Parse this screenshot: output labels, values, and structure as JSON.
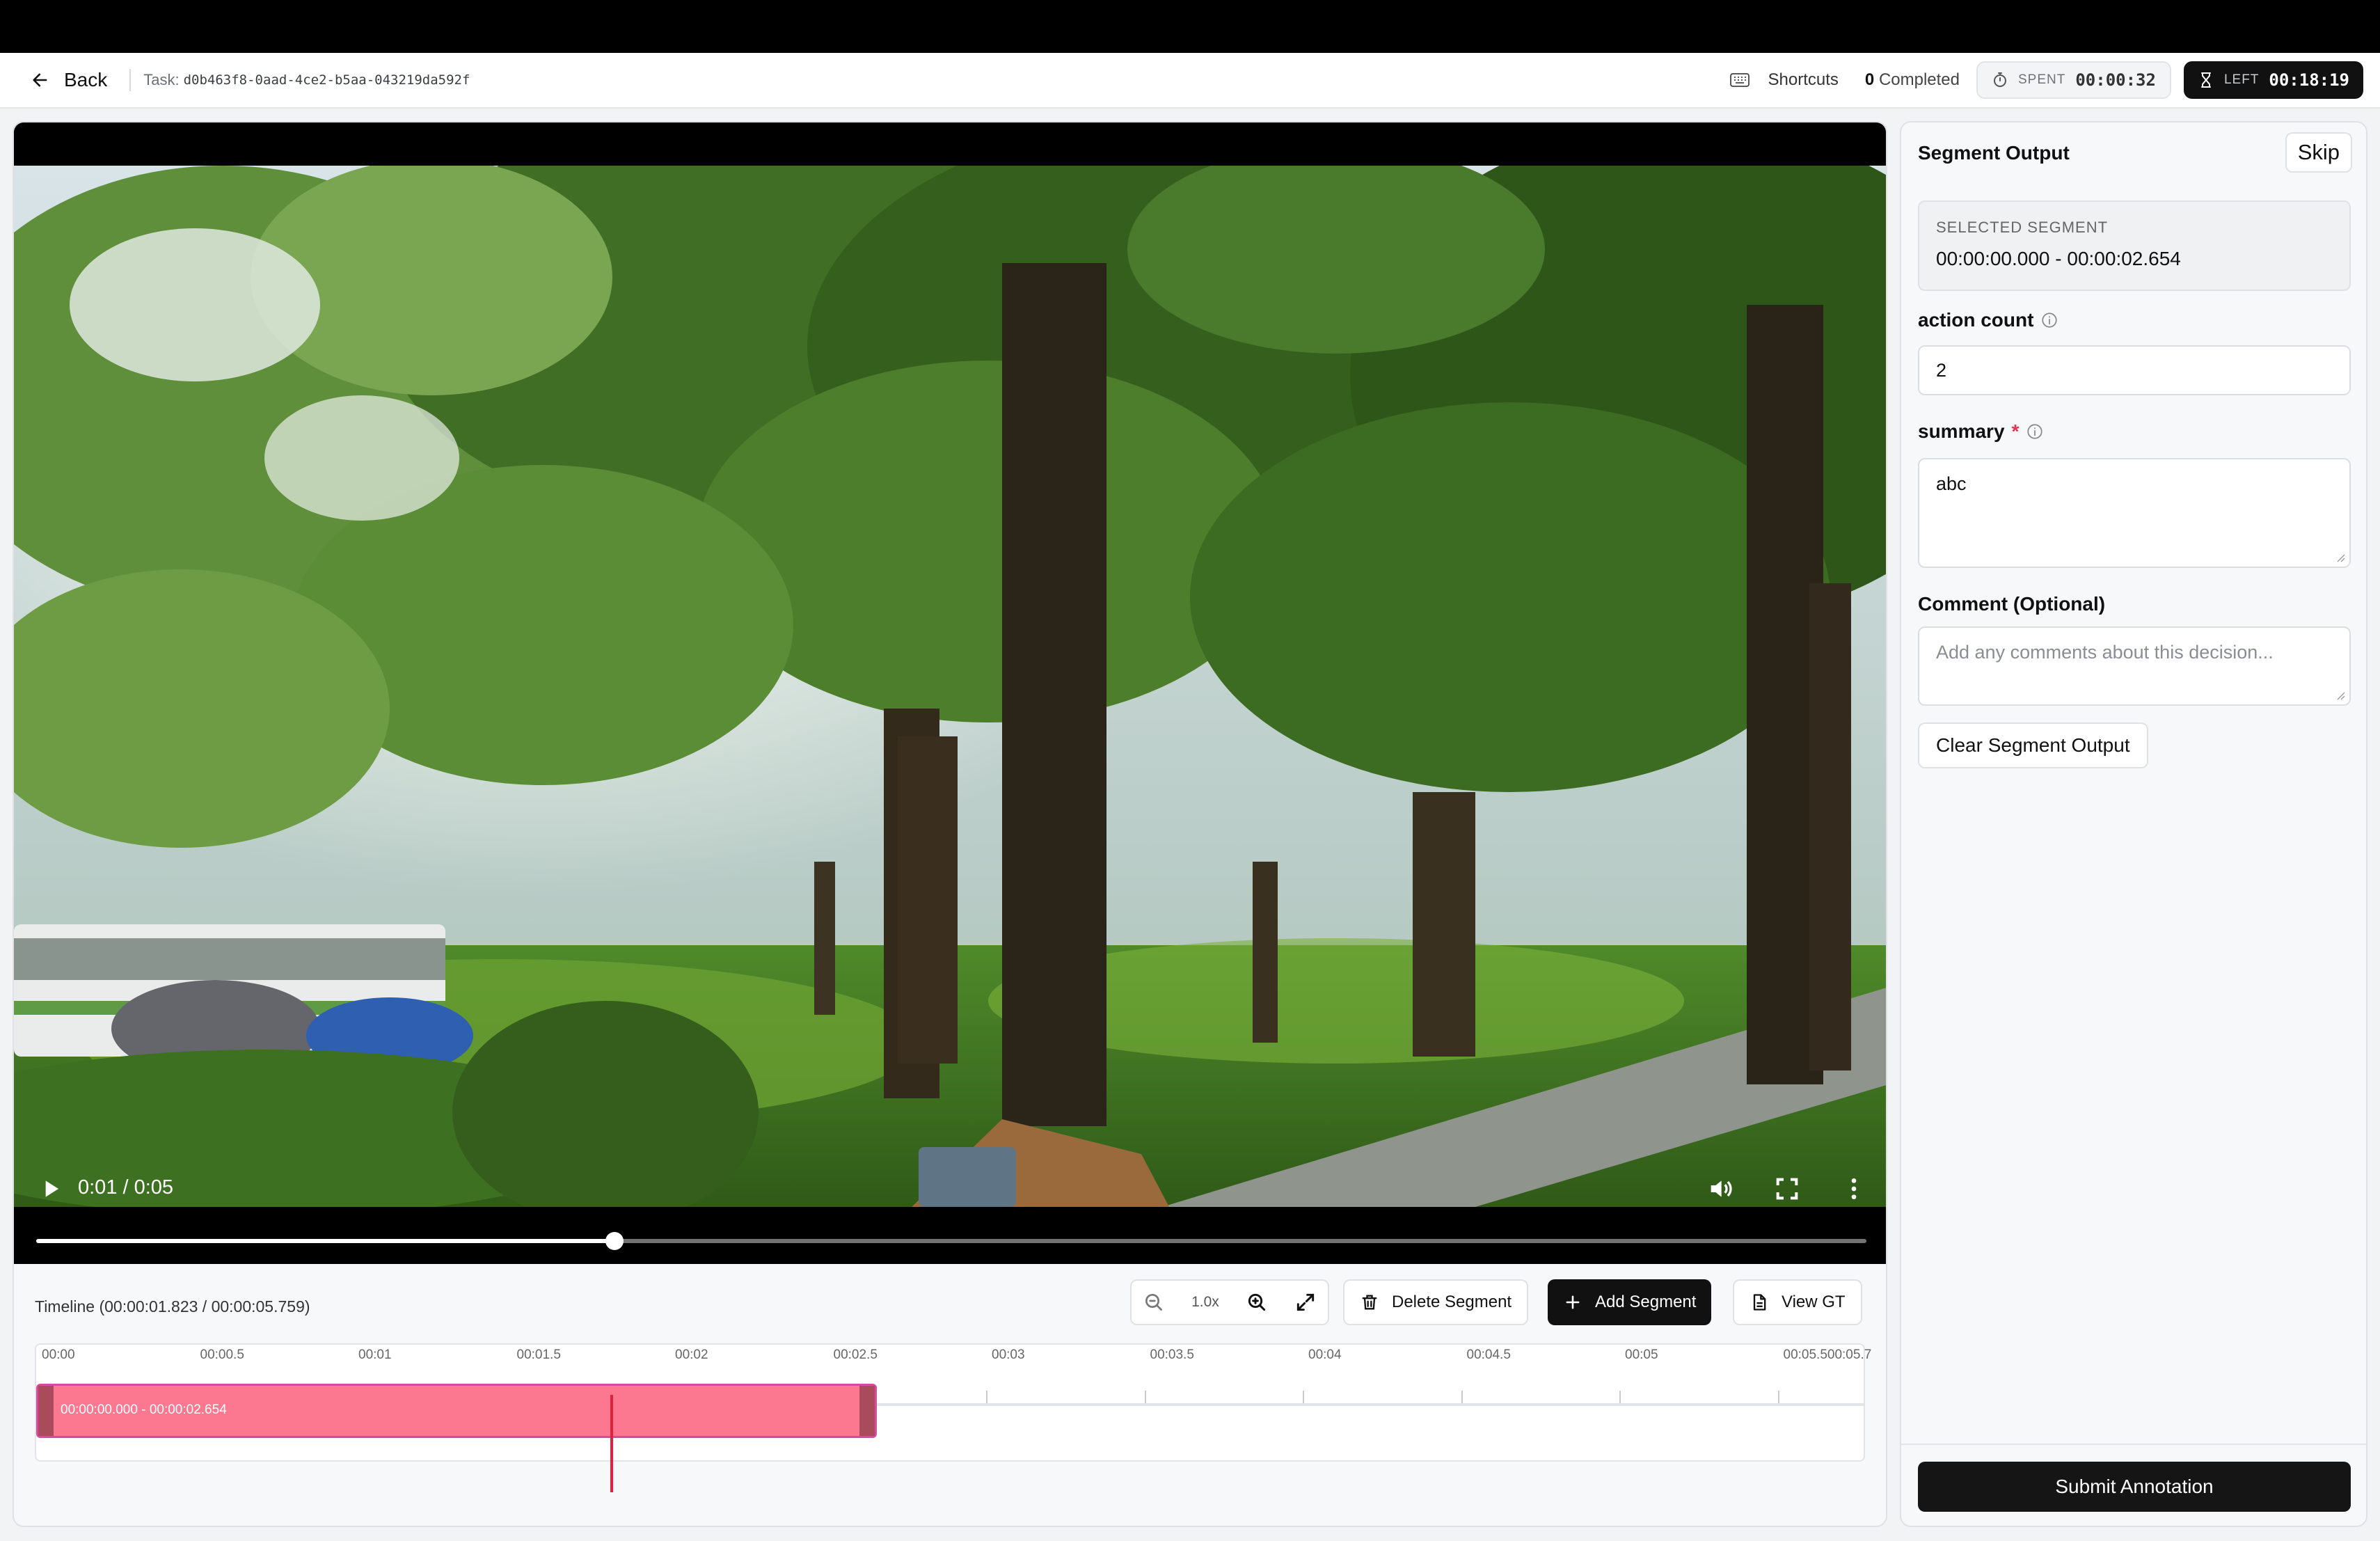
{
  "header": {
    "back_label": "Back",
    "task_label": "Task:",
    "task_id": "d0b463f8-0aad-4ce2-b5aa-043219da592f",
    "shortcuts_label": "Shortcuts",
    "completed_count": "0",
    "completed_label": "Completed",
    "spent_label": "SPENT",
    "spent_value": "00:00:32",
    "left_label": "LEFT",
    "left_value": "00:18:19"
  },
  "video": {
    "time_display": "0:01 / 0:05",
    "progress_fraction": 0.316,
    "icons": [
      "play-icon",
      "volume-icon",
      "fullscreen-icon",
      "more-vertical-icon"
    ]
  },
  "timeline": {
    "title": "Timeline (00:00:01.823 / 00:00:05.759)",
    "zoom_level": "1.0x",
    "delete_label": "Delete Segment",
    "add_label": "Add Segment",
    "view_gt_label": "View GT",
    "duration_seconds": 5.759,
    "playhead_seconds": 1.823,
    "ticks": [
      "00:00",
      "00:00.5",
      "00:01",
      "00:01.5",
      "00:02",
      "00:02.5",
      "00:03",
      "00:03.5",
      "00:04",
      "00:04.5",
      "00:05",
      "00:05.500:05.7"
    ],
    "segments": [
      {
        "label": "00:00:00.000 - 00:00:02.654",
        "start": 0.0,
        "end": 2.654
      }
    ]
  },
  "panel": {
    "title": "Segment Output",
    "skip_label": "Skip",
    "selected_label": "SELECTED SEGMENT",
    "selected_value": "00:00:00.000 - 00:00:02.654",
    "action_count_label": "action count",
    "action_count_value": "2",
    "summary_label": "summary",
    "summary_required_mark": "*",
    "summary_value": "abc",
    "comment_label": "Comment (Optional)",
    "comment_placeholder": "Add any comments about this decision...",
    "clear_label": "Clear Segment Output",
    "submit_label": "Submit Annotation"
  }
}
